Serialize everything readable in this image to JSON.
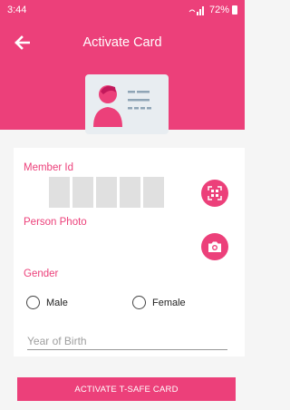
{
  "status_bar": {
    "time": "3:44",
    "battery": "72%"
  },
  "toolbar": {
    "title": "Activate Card"
  },
  "form": {
    "member_id_label": "Member Id",
    "person_photo_label": "Person Photo",
    "gender_label": "Gender",
    "gender_options": [
      "Male",
      "Female"
    ],
    "year_of_birth_placeholder": "Year of Birth",
    "year_of_birth_value": ""
  },
  "activate_button_label": "ACTIVATE T-SAFE CARD",
  "icons": {
    "back": "arrow-left-icon",
    "card": "id-card-icon",
    "scan": "qr-scan-icon",
    "camera": "camera-icon"
  },
  "colors": {
    "accent": "#ec407a",
    "placeholder": "#e0e0e0",
    "card_bg": "#e8edf1"
  }
}
